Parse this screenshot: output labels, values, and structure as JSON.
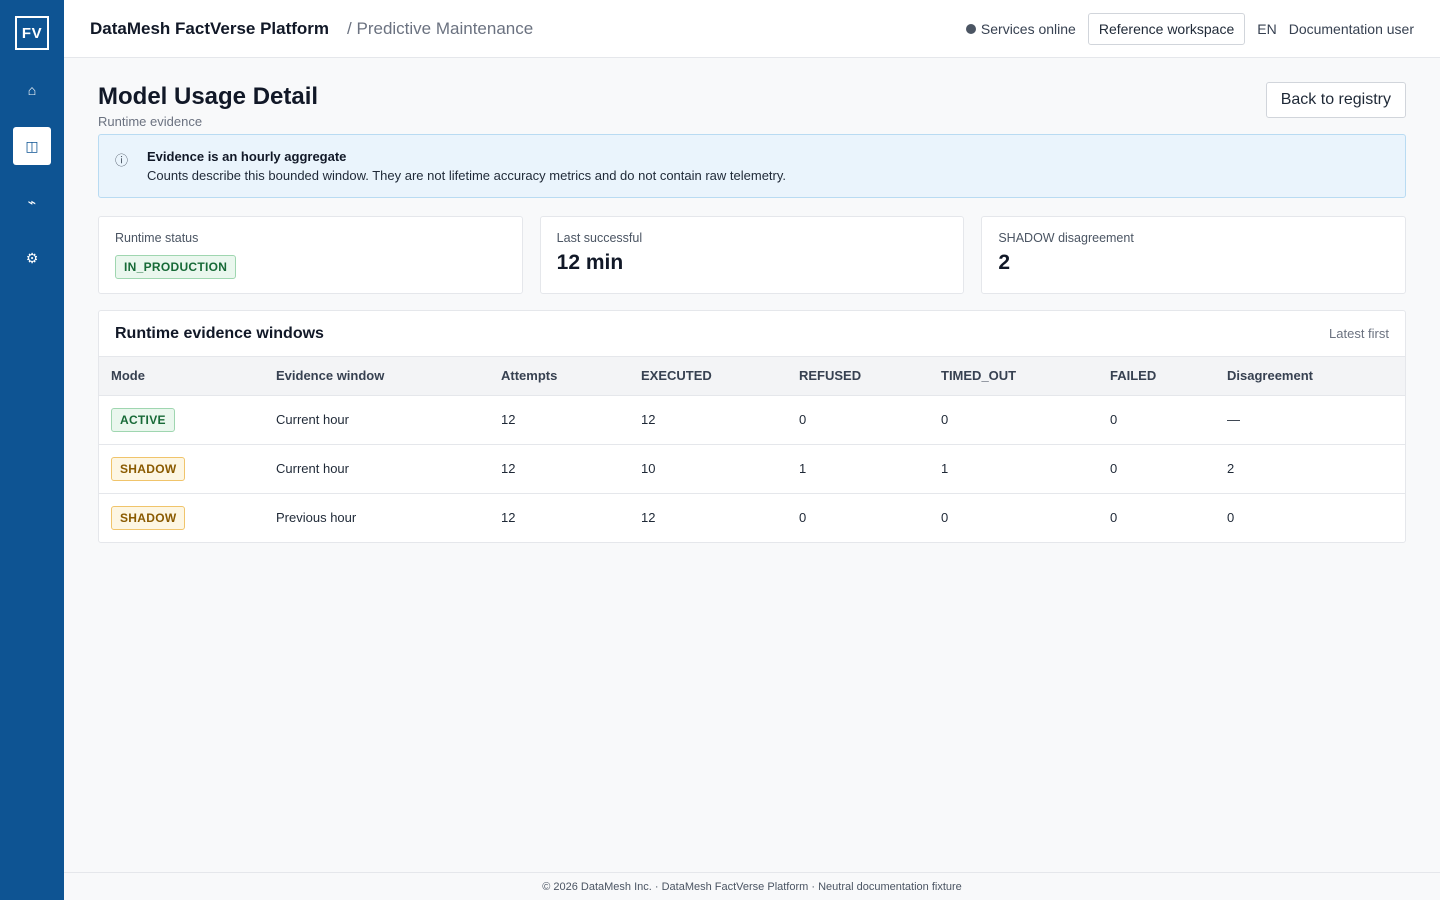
{
  "sidebar": {
    "logo": "FV",
    "items": [
      {
        "name": "home",
        "icon": "⌂"
      },
      {
        "name": "registry",
        "icon": "◫"
      },
      {
        "name": "activity",
        "icon": "⌁"
      },
      {
        "name": "settings",
        "icon": "⚙"
      }
    ]
  },
  "header": {
    "brand": "DataMesh FactVerse Platform",
    "breadcrumb": "/ Predictive Maintenance",
    "status": "Services online",
    "workspace_button": "Reference workspace",
    "language": "EN",
    "user": "Documentation user"
  },
  "page": {
    "title": "Model Usage Detail",
    "subtitle": "Runtime evidence",
    "back_button": "Back to registry"
  },
  "info": {
    "icon": "ⓘ",
    "title": "Evidence is an hourly aggregate",
    "text": "Counts describe this bounded window. They are not lifetime accuracy metrics and do not contain raw telemetry."
  },
  "cards": {
    "runtime_status": {
      "label": "Runtime status",
      "badge": "IN_PRODUCTION"
    },
    "last_successful": {
      "label": "Last successful",
      "value": "12 min"
    },
    "shadow_disagreement": {
      "label": "SHADOW disagreement",
      "value": "2"
    }
  },
  "evidence": {
    "title": "Runtime evidence windows",
    "sort": "Latest first",
    "columns": [
      "Mode",
      "Evidence window",
      "Attempts",
      "EXECUTED",
      "REFUSED",
      "TIMED_OUT",
      "FAILED",
      "Disagreement"
    ],
    "rows": [
      {
        "mode": "ACTIVE",
        "window": "Current hour",
        "attempts": "12",
        "executed": "12",
        "refused": "0",
        "timed_out": "0",
        "failed": "0",
        "disagreement": "—"
      },
      {
        "mode": "SHADOW",
        "window": "Current hour",
        "attempts": "12",
        "executed": "10",
        "refused": "1",
        "timed_out": "1",
        "failed": "0",
        "disagreement": "2"
      },
      {
        "mode": "SHADOW",
        "window": "Previous hour",
        "attempts": "12",
        "executed": "12",
        "refused": "0",
        "timed_out": "0",
        "failed": "0",
        "disagreement": "0"
      }
    ]
  },
  "footer": "© 2026 DataMesh Inc. · DataMesh FactVerse Platform · Neutral documentation fixture"
}
